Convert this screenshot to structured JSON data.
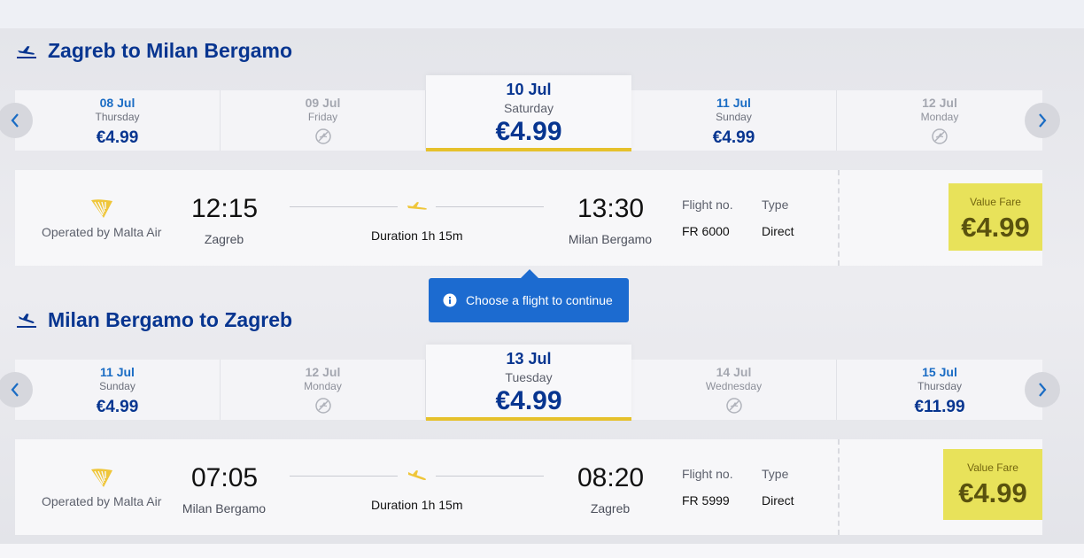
{
  "outbound": {
    "title": "Zagreb to Milan Bergamo",
    "days": [
      {
        "date": "08 Jul",
        "weekday": "Thursday",
        "price": "€4.99",
        "available": true
      },
      {
        "date": "09 Jul",
        "weekday": "Friday",
        "price": "",
        "available": false
      },
      {
        "date": "10 Jul",
        "weekday": "Saturday",
        "price": "€4.99",
        "available": true,
        "selected": true
      },
      {
        "date": "11 Jul",
        "weekday": "Sunday",
        "price": "€4.99",
        "available": true
      },
      {
        "date": "12 Jul",
        "weekday": "Monday",
        "price": "",
        "available": false
      }
    ],
    "flight": {
      "operated_by": "Operated by Malta Air",
      "depart_time": "12:15",
      "depart_city": "Zagreb",
      "duration": "Duration 1h 15m",
      "arrive_time": "13:30",
      "arrive_city": "Milan Bergamo",
      "flight_no_label": "Flight no.",
      "flight_no": "FR 6000",
      "type_label": "Type",
      "type": "Direct",
      "fare_label": "Value Fare",
      "fare_price": "€4.99"
    }
  },
  "tooltip": {
    "text": "Choose a flight to continue",
    "icon": "info-icon"
  },
  "inbound": {
    "title": "Milan Bergamo to Zagreb",
    "days": [
      {
        "date": "11 Jul",
        "weekday": "Sunday",
        "price": "€4.99",
        "available": true
      },
      {
        "date": "12 Jul",
        "weekday": "Monday",
        "price": "",
        "available": false
      },
      {
        "date": "13 Jul",
        "weekday": "Tuesday",
        "price": "€4.99",
        "available": true,
        "selected": true
      },
      {
        "date": "14 Jul",
        "weekday": "Wednesday",
        "price": "",
        "available": false
      },
      {
        "date": "15 Jul",
        "weekday": "Thursday",
        "price": "€11.99",
        "available": true
      }
    ],
    "flight": {
      "operated_by": "Operated by Malta Air",
      "depart_time": "07:05",
      "depart_city": "Milan Bergamo",
      "duration": "Duration 1h 15m",
      "arrive_time": "08:20",
      "arrive_city": "Zagreb",
      "flight_no_label": "Flight no.",
      "flight_no": "FR 5999",
      "type_label": "Type",
      "type": "Direct",
      "fare_label": "Value Fare",
      "fare_price": "€4.99"
    }
  },
  "colors": {
    "brand_blue": "#073590",
    "link_blue": "#1a6cc4",
    "selected_underline": "#e6c12b",
    "fare_bg": "#e8e25a",
    "tooltip_bg": "#1c6bd0"
  }
}
